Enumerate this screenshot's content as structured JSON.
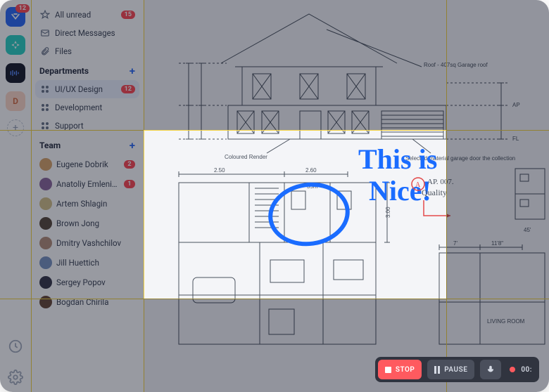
{
  "nav": {
    "all_unread": "All unread",
    "all_unread_badge": "15",
    "dm": "Direct Messages",
    "files": "Files"
  },
  "departments": {
    "title": "Departments",
    "items": [
      {
        "label": "UI/UX Design",
        "badge": "12",
        "active": true
      },
      {
        "label": "Development",
        "badge": ""
      },
      {
        "label": "Support",
        "badge": ""
      }
    ]
  },
  "team": {
    "title": "Team",
    "members": [
      {
        "name": "Eugene Dobrik",
        "badge": "2",
        "color": "#d9a56b"
      },
      {
        "name": "Anatoliy Emleninov",
        "badge": "1",
        "color": "#8e6a9e"
      },
      {
        "name": "Artem Shlagin",
        "badge": "",
        "color": "#d4c28a"
      },
      {
        "name": "Brown Jong",
        "badge": "",
        "color": "#5a4a3d"
      },
      {
        "name": "Dmitry Vashchilov",
        "badge": "",
        "color": "#b58f7a"
      },
      {
        "name": "Jill Huettich",
        "badge": "",
        "color": "#7a94c2"
      },
      {
        "name": "Sergey Popov",
        "badge": "",
        "color": "#3a3a4a"
      },
      {
        "name": "Bogdan Chirila",
        "badge": "",
        "color": "#6a4a3a"
      }
    ]
  },
  "annotation": {
    "line1": "This is",
    "line2": "Nice!",
    "callout": "AP. 007.",
    "callout2": "Quality"
  },
  "blueprint": {
    "dim_250": "2.50",
    "dim_260": "2.60",
    "dim_300": "3.00",
    "dim_7": "7'",
    "dim_118": "11'8\"",
    "dim_45": "45'",
    "label_render": "Coloured Render",
    "label_roof": "Roof - 407sq\nGarage roof",
    "label_garage": "Selected material garage door\nthe collection",
    "label_living": "LIVING\nROOM",
    "mark_fl": "FL",
    "mark_ap": "AP",
    "vmeasure_small": "35m"
  },
  "rec": {
    "stop": "STOP",
    "pause": "PAUSE",
    "time": "00:"
  },
  "avatar_initial": "D",
  "rail_badge": "12"
}
